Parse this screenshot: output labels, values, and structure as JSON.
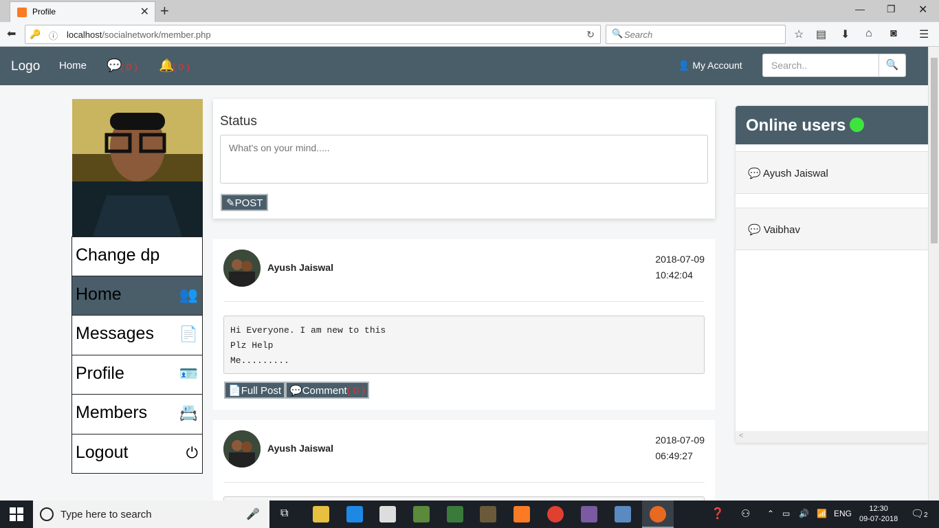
{
  "browser": {
    "tab_title": "Profile",
    "url_host": "localhost",
    "url_path": "/socialnetwork/member.php",
    "search_placeholder": "Search"
  },
  "site": {
    "logo": "Logo",
    "nav_home": "Home",
    "messages_count": "( 0 )",
    "notifications_count": "( 0 )",
    "my_account": "My Account",
    "search_placeholder": "Search.."
  },
  "sidebar": {
    "items": [
      {
        "label": "Change dp",
        "icon": ""
      },
      {
        "label": "Home",
        "icon": "users-icon"
      },
      {
        "label": "Messages",
        "icon": "file-icon"
      },
      {
        "label": "Profile",
        "icon": "id-card-icon"
      },
      {
        "label": "Members",
        "icon": "address-book-icon"
      },
      {
        "label": "Logout",
        "icon": "power-icon"
      }
    ]
  },
  "status": {
    "label": "Status",
    "placeholder": "What's on your mind.....",
    "post_button": "POST"
  },
  "posts": [
    {
      "author": "Ayush Jaiswal",
      "date": "2018-07-09",
      "time": "10:42:04",
      "body": "Hi Everyone. I am new to this\nPlz Help\nMe.........",
      "full_post_label": "Full Post",
      "comment_label": "Comment",
      "comment_count": "( 0 )"
    },
    {
      "author": "Ayush Jaiswal",
      "date": "2018-07-09",
      "time": "06:49:27"
    }
  ],
  "online": {
    "title": "Online users",
    "users": [
      "Ayush Jaiswal",
      "Vaibhav"
    ]
  },
  "taskbar": {
    "search_text": "Type here to search",
    "lang": "ENG",
    "time": "12:30",
    "date": "09-07-2018",
    "notifications": "2"
  },
  "colors": {
    "header": "#4a5e6a",
    "online_dot": "#3ee43e",
    "count_red": "#d33333"
  }
}
